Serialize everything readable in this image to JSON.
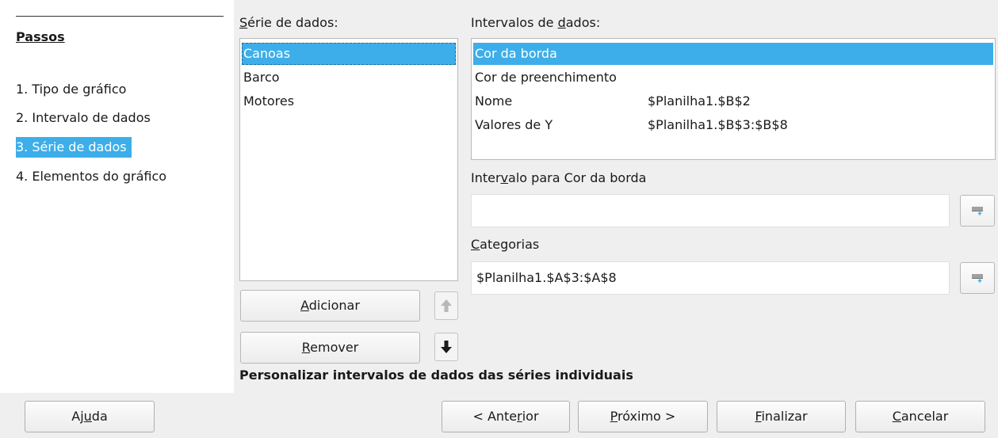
{
  "steps": {
    "title": "Passos",
    "items": [
      {
        "label": "1. Tipo de gráfico",
        "active": false
      },
      {
        "label": "2. Intervalo de dados",
        "active": false
      },
      {
        "label": "3. Série de dados",
        "active": true
      },
      {
        "label": "4. Elementos do gráfico",
        "active": false
      }
    ]
  },
  "series": {
    "label_pre": "",
    "label_mnemonic": "S",
    "label_post": "érie de dados:",
    "items": [
      "Canoas",
      "Barco",
      "Motores"
    ],
    "selected": "Canoas",
    "add_pre": "",
    "add_mnemonic": "A",
    "add_post": "dicionar",
    "remove_pre": "",
    "remove_mnemonic": "R",
    "remove_post": "emover",
    "up_icon": "arrow-up-icon",
    "down_icon": "arrow-down-icon"
  },
  "ranges": {
    "label_pre": "Intervalos de ",
    "label_mnemonic": "d",
    "label_post": "ados:",
    "rows": [
      {
        "name": "Cor da borda",
        "value": "",
        "selected": true
      },
      {
        "name": "Cor de preenchimento",
        "value": "",
        "selected": false
      },
      {
        "name": "Nome",
        "value": "$Planilha1.$B$2",
        "selected": false
      },
      {
        "name": "Valores de Y",
        "value": "$Planilha1.$B$3:$B$8",
        "selected": false
      }
    ]
  },
  "range_for": {
    "label_pre": "Inter",
    "label_mnemonic": "v",
    "label_post": "alo para Cor da borda",
    "value": ""
  },
  "categories": {
    "label_pre": "",
    "label_mnemonic": "C",
    "label_post": "ategorias",
    "value": "$Planilha1.$A$3:$A$8"
  },
  "hint": "Personalizar intervalos de dados das séries individuais",
  "buttons": {
    "help": {
      "pre": "Aj",
      "m": "u",
      "post": "da"
    },
    "back": {
      "pre": "< Ante",
      "m": "r",
      "post": "ior"
    },
    "next": {
      "pre": "",
      "m": "P",
      "post": "róximo >"
    },
    "finish": {
      "pre": "",
      "m": "F",
      "post": "inalizar"
    },
    "cancel": {
      "pre": "",
      "m": "C",
      "post": "ancelar"
    }
  },
  "colors": {
    "accent": "#3daee9"
  }
}
